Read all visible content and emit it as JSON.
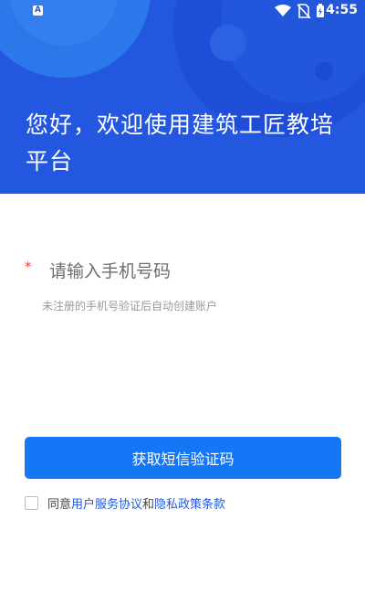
{
  "status_bar": {
    "notification_badge": "A",
    "time": "4:55",
    "icons": [
      "wifi-icon",
      "no-sim-icon",
      "battery-charging-icon"
    ]
  },
  "header": {
    "title": "您好，欢迎使用建筑工匠教培平台",
    "background_color": "#2457e0"
  },
  "form": {
    "required_mark": "*",
    "phone_placeholder": "请输入手机号码",
    "phone_value": "",
    "hint": "未注册的手机号验证后自动创建账户"
  },
  "actions": {
    "sms_button_label": "获取短信验证码",
    "button_color": "#1577f5"
  },
  "agreement": {
    "checked": false,
    "prefix": "同意",
    "user_agreement_link": "用户服务协议",
    "conjunction": "和",
    "privacy_link": "隐私政策条款"
  }
}
